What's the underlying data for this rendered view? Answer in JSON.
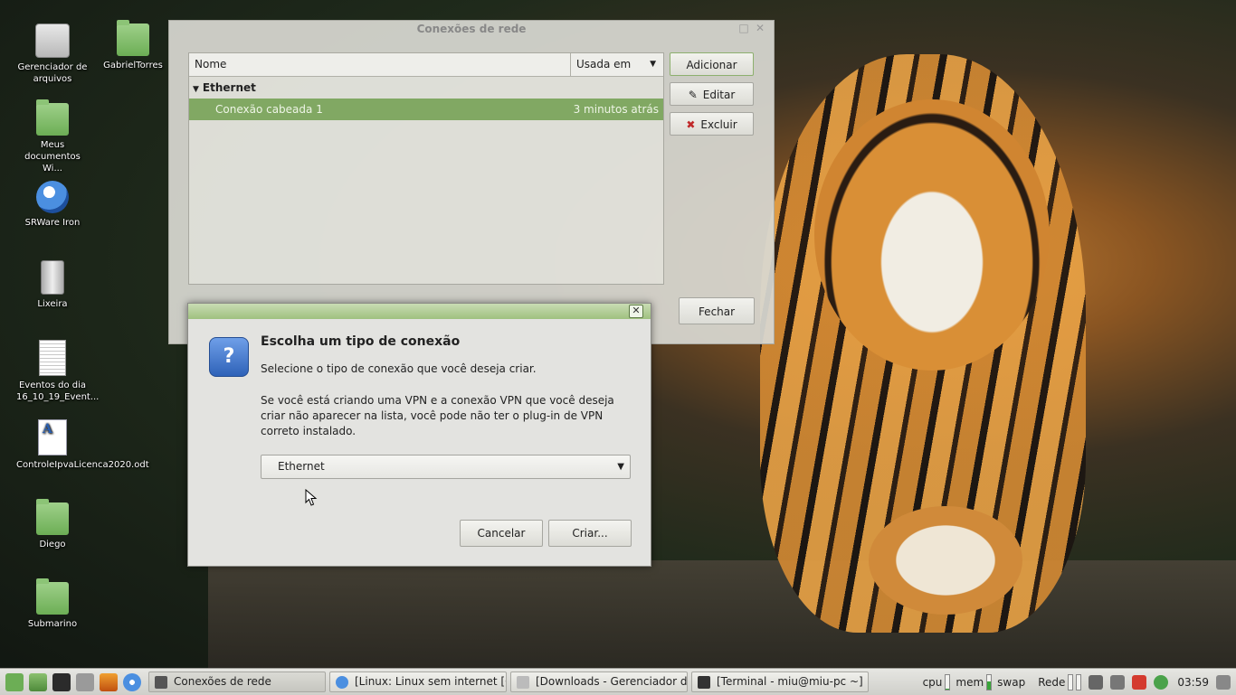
{
  "desktop": {
    "icons": [
      {
        "label": "Gerenciador de arquivos",
        "icon": "drive-icon"
      },
      {
        "label": "GabrielTorres",
        "icon": "folder-icon"
      },
      {
        "label": "Meus documentos Wi...",
        "icon": "folder-icon"
      },
      {
        "label": "SRWare Iron",
        "icon": "browser-globe-icon"
      },
      {
        "label": "Lixeira",
        "icon": "trash-icon"
      },
      {
        "label": "Eventos do dia 16_10_19_Event...",
        "icon": "spreadsheet-doc-icon"
      },
      {
        "label": "ControleIpvaLicenca2020.odt",
        "icon": "odt-doc-icon"
      },
      {
        "label": "Diego",
        "icon": "folder-icon"
      },
      {
        "label": "Submarino",
        "icon": "folder-icon"
      }
    ]
  },
  "main_window": {
    "title": "Conexões de rede",
    "columns": {
      "name": "Nome",
      "used": "Usada em"
    },
    "group": "Ethernet",
    "connection": {
      "name": "Conexão cabeada 1",
      "used": "3 minutos atrás"
    },
    "buttons": {
      "add": "Adicionar",
      "edit": "Editar",
      "delete": "Excluir",
      "close": "Fechar"
    }
  },
  "dialog": {
    "heading": "Escolha um tipo de conexão",
    "subtitle": "Selecione o tipo de conexão que você deseja criar.",
    "info": "Se você está criando uma VPN e a conexão VPN que você deseja criar não aparecer na lista, você pode não ter o plug-in de VPN correto instalado.",
    "selected_type": "Ethernet",
    "cancel": "Cancelar",
    "create": "Criar..."
  },
  "taskbar": {
    "tasks": [
      {
        "label": "Conexões de rede",
        "active": true
      },
      {
        "label": "[Linux: Linux sem internet [C...",
        "active": false
      },
      {
        "label": "[Downloads - Gerenciador d...",
        "active": false
      },
      {
        "label": "[Terminal - miu@miu-pc ~]",
        "active": false
      }
    ],
    "tray": {
      "cpu": "cpu",
      "mem": "mem",
      "swap": "swap",
      "net": "Rede",
      "clock": "03:59"
    },
    "colors": {
      "accent": "#81a863",
      "meter": "#3aa53a"
    }
  }
}
